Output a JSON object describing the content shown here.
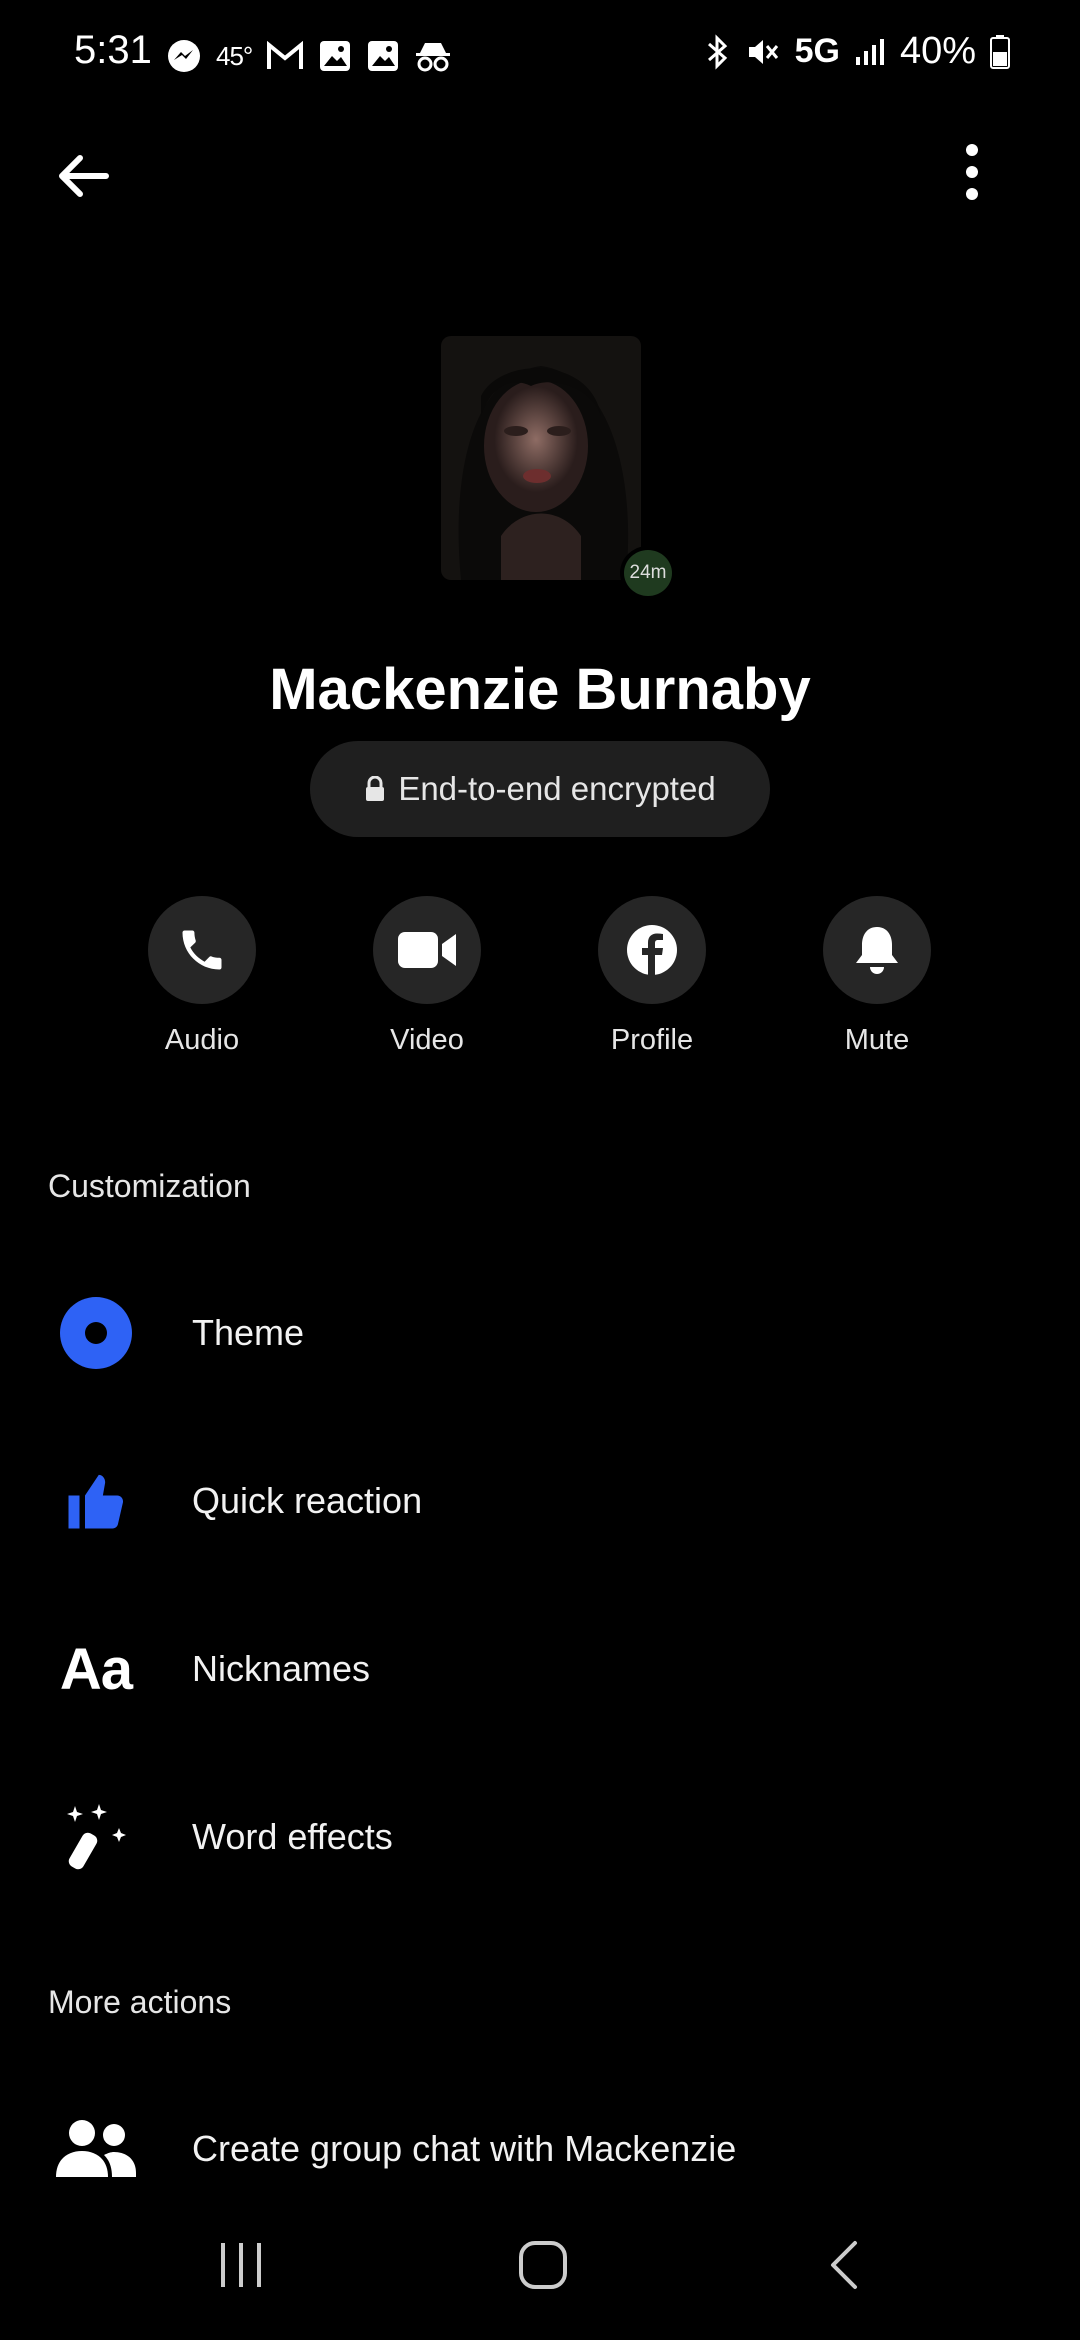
{
  "status_bar": {
    "time": "5:31",
    "temperature": "45°",
    "network": "5G",
    "battery": "40%"
  },
  "contact": {
    "name": "Mackenzie Burnaby",
    "active_badge": "24m",
    "encryption_label": "End-to-end encrypted"
  },
  "actions": [
    {
      "label": "Audio",
      "icon": "phone-icon"
    },
    {
      "label": "Video",
      "icon": "video-camera-icon"
    },
    {
      "label": "Profile",
      "icon": "facebook-icon"
    },
    {
      "label": "Mute",
      "icon": "bell-icon"
    }
  ],
  "sections": {
    "customization": {
      "title": "Customization",
      "items": [
        {
          "label": "Theme",
          "icon": "theme-icon"
        },
        {
          "label": "Quick reaction",
          "icon": "thumbs-up-icon"
        },
        {
          "label": "Nicknames",
          "icon": "nicknames-icon",
          "icon_text": "Aa"
        },
        {
          "label": "Word effects",
          "icon": "magic-wand-icon"
        }
      ]
    },
    "more_actions": {
      "title": "More actions",
      "items": [
        {
          "label": "Create group chat with Mackenzie",
          "icon": "group-icon"
        }
      ]
    }
  },
  "colors": {
    "accent": "#2e62f5",
    "background": "#000000",
    "button_bg": "#262626"
  }
}
